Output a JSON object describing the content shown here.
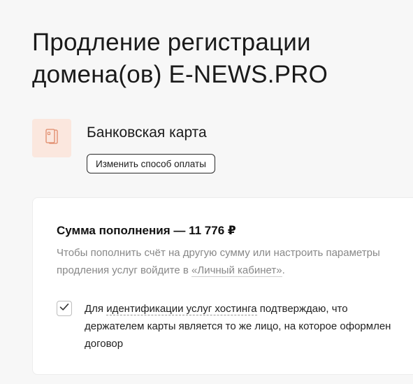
{
  "header": {
    "title_line1": "Продление регистрации",
    "title_line2": "домена(ов) E-NEWS.PRO"
  },
  "payment_method": {
    "icon": "bank-card-icon",
    "label": "Банковская карта",
    "change_button_label": "Изменить способ оплаты",
    "icon_bg_color": "#fbe7de",
    "icon_color": "#e08a6a"
  },
  "summary": {
    "amount_title": "Сумма пополнения — 11 776 ₽",
    "description_prefix": "Чтобы пополнить счёт на другую сумму или настроить параметры продления услуг войдите в ",
    "cabinet_link": "«Личный кабинет»",
    "description_suffix": "."
  },
  "agreement": {
    "checked": true,
    "text_prefix": "Для ",
    "link_identification": "идентификации услуг хостинга",
    "text_suffix": " подтверждаю, что держателем карты является то же лицо, на которое оформлен договор"
  }
}
